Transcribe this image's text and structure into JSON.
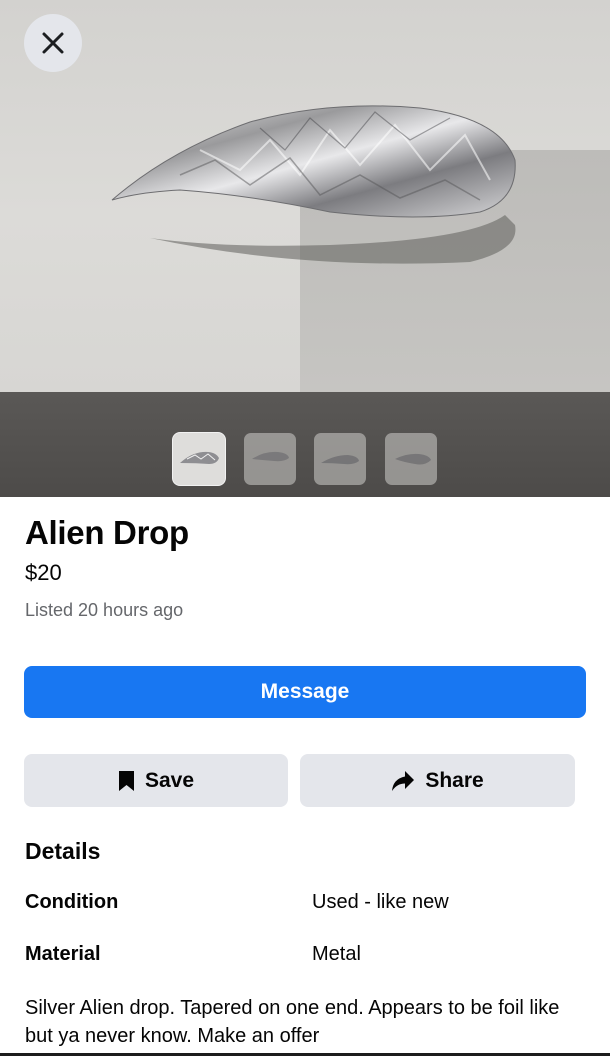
{
  "listing": {
    "title": "Alien Drop",
    "price": "$20",
    "listed": "Listed 20 hours ago",
    "description": "Silver Alien drop. Tapered on one end. Appears to be foil like but ya never know. Make an offer"
  },
  "actions": {
    "message_label": "Message",
    "save_label": "Save",
    "share_label": "Share"
  },
  "details": {
    "heading": "Details",
    "rows": [
      {
        "label": "Condition",
        "value": "Used - like new"
      },
      {
        "label": "Material",
        "value": "Metal"
      }
    ]
  },
  "gallery": {
    "photo_count": 4,
    "selected_index": 0
  },
  "icons": {
    "close": "close-icon",
    "save": "bookmark-icon",
    "share": "share-arrow-icon"
  },
  "colors": {
    "primary": "#1877f2",
    "secondary_button": "#e4e6eb",
    "muted_text": "#65676b"
  }
}
